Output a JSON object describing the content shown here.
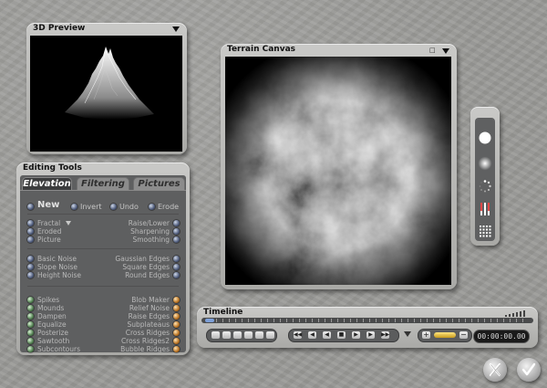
{
  "preview": {
    "title": "3D Preview"
  },
  "editing_tools": {
    "title": "Editing Tools",
    "tabs": [
      "Elevation",
      "Filtering",
      "Pictures"
    ],
    "top_actions": {
      "new": "New",
      "invert": "Invert",
      "undo": "Undo",
      "erode": "Erode"
    },
    "group1_left": [
      "Fractal",
      "Eroded",
      "Picture"
    ],
    "group1_right": [
      "Raise/Lower",
      "Sharpening",
      "Smoothing"
    ],
    "group2_left": [
      "Basic Noise",
      "Slope Noise",
      "Height Noise"
    ],
    "group2_right": [
      "Gaussian Edges",
      "Square Edges",
      "Round Edges"
    ],
    "group3_left": [
      "Spikes",
      "Mounds",
      "Dampen",
      "Equalize",
      "Posterize",
      "Sawtooth",
      "Subcontours"
    ],
    "group3_right": [
      "Blob Maker",
      "Relief Noise",
      "Raise Edges",
      "Subplateaus",
      "Cross Ridges",
      "Cross Ridges2",
      "Bubble Ridges"
    ]
  },
  "canvas": {
    "title": "Terrain Canvas"
  },
  "toolbar": {
    "icons": [
      "brush-hard-icon",
      "brush-soft-icon",
      "brush-spray-icon",
      "gradient-brush-icon",
      "grid-brush-icon"
    ]
  },
  "timeline": {
    "title": "Timeline",
    "timecode": "00:00:00.00",
    "transport": [
      "first",
      "prev-key",
      "rewind",
      "stop",
      "play",
      "next-key",
      "last"
    ]
  },
  "footer": {
    "cancel_icon": "x-icon",
    "ok_icon": "check-icon"
  }
}
